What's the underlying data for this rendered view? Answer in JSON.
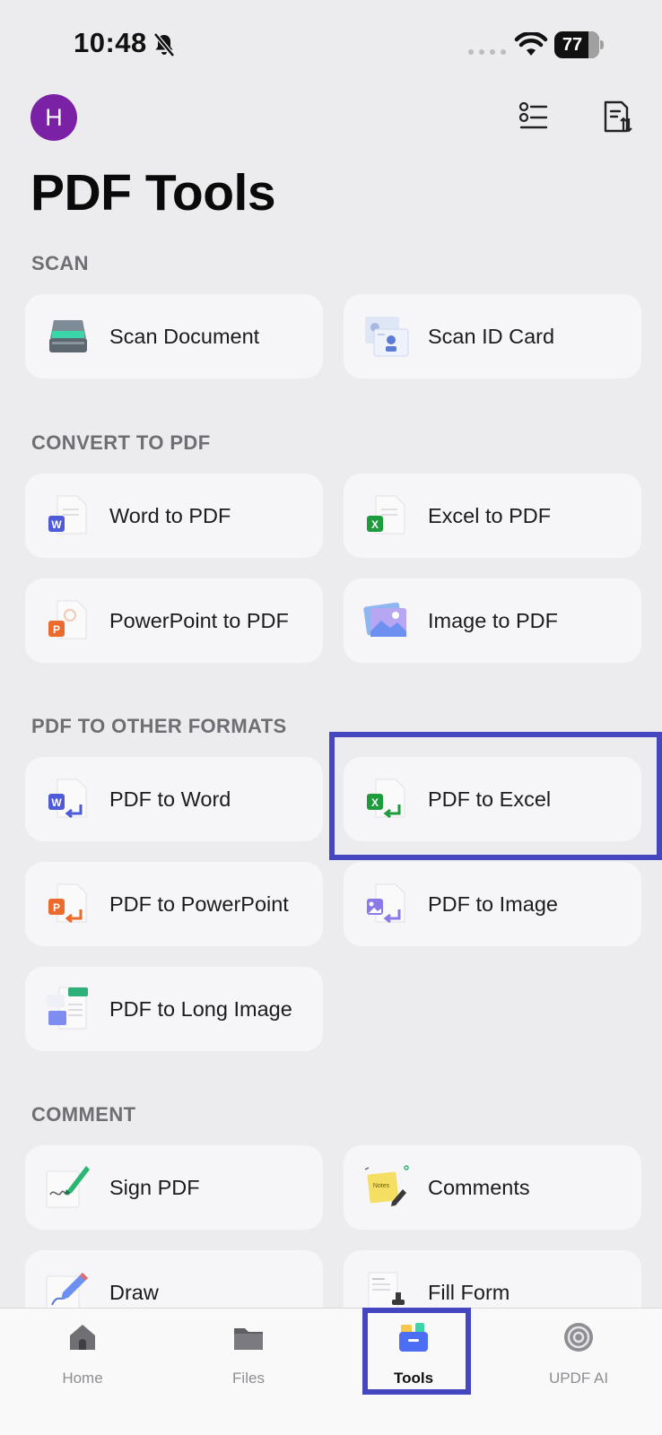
{
  "status_bar": {
    "time": "10:48",
    "battery": "77"
  },
  "header": {
    "avatar_initial": "H",
    "title": "PDF Tools"
  },
  "sections": {
    "scan": {
      "label": "SCAN",
      "items": [
        "Scan Document",
        "Scan ID Card"
      ]
    },
    "convert_to_pdf": {
      "label": "CONVERT TO PDF",
      "items": [
        "Word to PDF",
        "Excel to PDF",
        "PowerPoint to PDF",
        "Image to PDF"
      ]
    },
    "pdf_to_other": {
      "label": "PDF TO OTHER FORMATS",
      "items": [
        "PDF to Word",
        "PDF to Excel",
        "PDF to PowerPoint",
        "PDF to Image",
        "PDF to Long Image"
      ]
    },
    "comment": {
      "label": "COMMENT",
      "items": [
        "Sign PDF",
        "Comments",
        "Draw",
        "Fill Form"
      ]
    }
  },
  "tab_bar": {
    "tabs": [
      "Home",
      "Files",
      "Tools",
      "UPDF AI"
    ],
    "active": "Tools"
  },
  "colors": {
    "accent_highlight": "#4547c0",
    "avatar": "#7b21a6",
    "word_blue": "#4e5bd8",
    "excel_green": "#1e9b3c",
    "ppt_orange": "#ec6a2c"
  }
}
